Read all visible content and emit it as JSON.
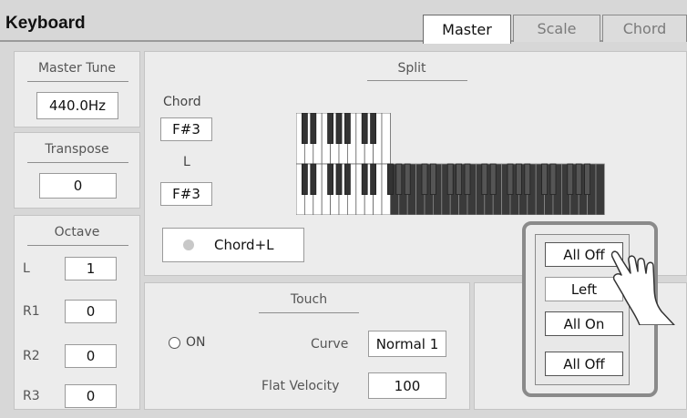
{
  "app": {
    "title": "Keyboard"
  },
  "tabs": [
    {
      "label": "Master",
      "active": true
    },
    {
      "label": "Scale",
      "active": false
    },
    {
      "label": "Chord",
      "active": false
    }
  ],
  "master_tune": {
    "label": "Master Tune",
    "value": "440.0Hz"
  },
  "transpose": {
    "label": "Transpose",
    "value": "0"
  },
  "octave": {
    "label": "Octave",
    "rows": [
      {
        "label": "L",
        "value": "1"
      },
      {
        "label": "R1",
        "value": "0"
      },
      {
        "label": "R2",
        "value": "0"
      },
      {
        "label": "R3",
        "value": "0"
      }
    ]
  },
  "split": {
    "label": "Split",
    "chord_label": "Chord",
    "chord_value": "F#3",
    "l_label": "L",
    "l_value": "F#3",
    "mode_button": "Chord+L"
  },
  "touch": {
    "label": "Touch",
    "on_label": "ON",
    "curve_label": "Curve",
    "curve_value": "Normal 1",
    "flat_velocity_label": "Flat Velocity",
    "flat_velocity_value": "100"
  },
  "popup": {
    "options": [
      "All Off",
      "Left",
      "All On",
      "All Off"
    ]
  },
  "colors": {
    "background": "#d7d7d7",
    "panel": "#ececec",
    "highlight_keys": "#3a3a3a",
    "popup_border": "#8a8a8a"
  },
  "icons": [
    "radio-icon",
    "toggle-indicator-icon",
    "hand-pointer-icon"
  ]
}
